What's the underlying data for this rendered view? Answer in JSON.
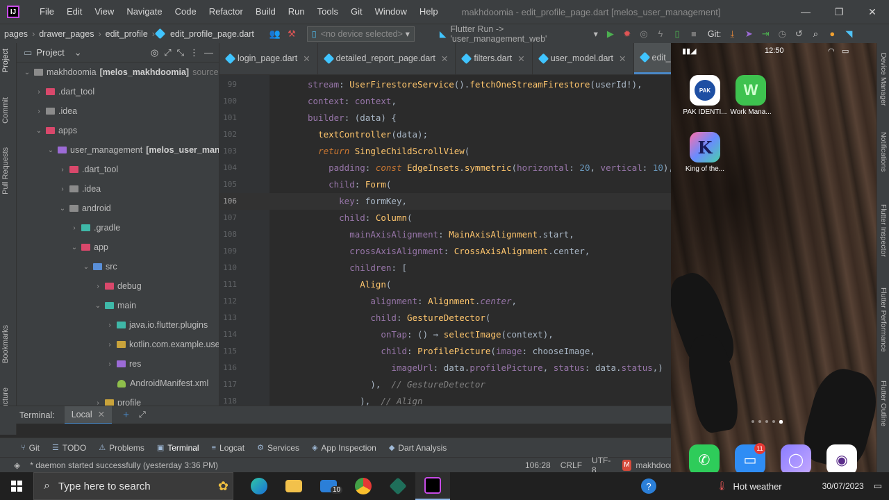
{
  "menubar": {
    "logo": "IJ",
    "items": [
      "File",
      "Edit",
      "View",
      "Navigate",
      "Code",
      "Refactor",
      "Build",
      "Run",
      "Tools",
      "Git",
      "Window",
      "Help"
    ],
    "window_title": "makhdoomia - edit_profile_page.dart [melos_user_management]",
    "controls": [
      "—",
      "❐",
      "✕"
    ]
  },
  "navbar": {
    "breadcrumbs": [
      "pages",
      "drawer_pages",
      "edit_profile",
      "edit_profile_page.dart"
    ],
    "device_select": "<no device selected>",
    "run_config": "Flutter Run -> 'user_management_web'",
    "git_label": "Git:"
  },
  "left_strip": {
    "tabs": [
      "Project",
      "Commit",
      "Pull Requests",
      "Bookmarks",
      "Structure"
    ]
  },
  "project_panel": {
    "title": "Project",
    "tree": [
      {
        "name": "makhdoomia",
        "extra": "[melos_makhdoomia]",
        "dim": "sources r",
        "arrow": "v",
        "icon": "grey",
        "indent": 0
      },
      {
        "name": ".dart_tool",
        "arrow": ">",
        "icon": "red",
        "indent": 1
      },
      {
        "name": ".idea",
        "arrow": ">",
        "icon": "grey",
        "indent": 1
      },
      {
        "name": "apps",
        "arrow": "v",
        "icon": "red",
        "indent": 1
      },
      {
        "name": "user_management",
        "extra": "[melos_user_manager",
        "arrow": "v",
        "icon": "purple",
        "indent": 2
      },
      {
        "name": ".dart_tool",
        "arrow": ">",
        "icon": "red",
        "indent": 3
      },
      {
        "name": ".idea",
        "arrow": ">",
        "icon": "grey",
        "indent": 3
      },
      {
        "name": "android",
        "arrow": "v",
        "icon": "grey",
        "indent": 3
      },
      {
        "name": ".gradle",
        "arrow": ">",
        "icon": "teal",
        "indent": 4
      },
      {
        "name": "app",
        "arrow": "v",
        "icon": "red",
        "indent": 4
      },
      {
        "name": "src",
        "arrow": "v",
        "icon": "blue",
        "indent": 5
      },
      {
        "name": "debug",
        "arrow": ">",
        "icon": "red",
        "indent": 6
      },
      {
        "name": "main",
        "arrow": "v",
        "icon": "teal",
        "indent": 6
      },
      {
        "name": "java.io.flutter.plugins",
        "arrow": ">",
        "icon": "teal",
        "indent": 7
      },
      {
        "name": "kotlin.com.example.user_",
        "arrow": ">",
        "icon": "yellow",
        "indent": 7
      },
      {
        "name": "res",
        "arrow": ">",
        "icon": "purple",
        "indent": 7
      },
      {
        "name": "AndroidManifest.xml",
        "arrow": "",
        "icon": "droid",
        "indent": 7
      },
      {
        "name": "profile",
        "arrow": ">",
        "icon": "yellow",
        "indent": 6
      }
    ]
  },
  "editor_tabs": [
    {
      "label": "login_page.dart",
      "active": false
    },
    {
      "label": "detailed_report_page.dart",
      "active": false
    },
    {
      "label": "filters.dart",
      "active": false
    },
    {
      "label": "user_model.dart",
      "active": false
    },
    {
      "label": "edit_profile_page.dart",
      "active": true
    }
  ],
  "editor": {
    "current_line": 106,
    "lines": [
      {
        "n": "99",
        "html": "<span class='p'>stream</span><span class='t'>: </span><span class='f'>UserFirestoreService</span><span class='t'>().</span><span class='f'>fetchOneStreamFirestore</span><span class='t'>(userId!),</span>"
      },
      {
        "n": "100",
        "html": "<span class='p'>context</span><span class='t'>: </span><span class='p'>context</span><span class='t'>,</span>"
      },
      {
        "n": "101",
        "html": "<span class='p'>builder</span><span class='t'>: (data) {</span>"
      },
      {
        "n": "102",
        "html": "  <span class='f'>textController</span><span class='t'>(data);</span>"
      },
      {
        "n": "103",
        "html": "  <span class='it'>return</span> <span class='f'>SingleChildScrollView</span><span class='t'>(</span>"
      },
      {
        "n": "104",
        "html": "    <span class='p'>padding</span><span class='t'>: </span><span class='it'>const</span> <span class='f'>EdgeInsets</span><span class='t'>.</span><span class='f'>symmetric</span><span class='t'>(</span><span class='p'>horizontal</span><span class='t'>: </span><span class='n'>20</span><span class='t'>, </span><span class='p'>vertical</span><span class='t'>: </span><span class='n'>10</span><span class='t'>),</span>"
      },
      {
        "n": "105",
        "html": "    <span class='p'>child</span><span class='t'>: </span><span class='f'>Form</span><span class='t'>(</span>"
      },
      {
        "n": "106",
        "html": "      <span class='p'>key</span><span class='t'>: formKey,</span>"
      },
      {
        "n": "107",
        "html": "      <span class='p'>child</span><span class='t'>: </span><span class='f'>Column</span><span class='t'>(</span>"
      },
      {
        "n": "108",
        "html": "        <span class='p'>mainAxisAlignment</span><span class='t'>: </span><span class='f'>MainAxisAlignment</span><span class='t'>.start,</span>"
      },
      {
        "n": "109",
        "html": "        <span class='p'>crossAxisAlignment</span><span class='t'>: </span><span class='f'>CrossAxisAlignment</span><span class='t'>.center,</span>"
      },
      {
        "n": "110",
        "html": "        <span class='p'>children</span><span class='t'>: [</span>"
      },
      {
        "n": "111",
        "html": "          <span class='f'>Align</span><span class='t'>(</span>"
      },
      {
        "n": "112",
        "html": "            <span class='p'>alignment</span><span class='t'>: </span><span class='f'>Alignment</span><span class='t'>.</span><span class='p' style='font-style:italic'>center</span><span class='t'>,</span>"
      },
      {
        "n": "113",
        "html": "            <span class='p'>child</span><span class='t'>: </span><span class='f'>GestureDetector</span><span class='t'>(</span>"
      },
      {
        "n": "114",
        "html": "              <span class='p'>onTap</span><span class='t'>: () ⇒ </span><span class='f'>selectImage</span><span class='t'>(context),</span>"
      },
      {
        "n": "115",
        "html": "              <span class='p'>child</span><span class='t'>: </span><span class='f'>ProfilePicture</span><span class='t'>(</span><span class='p'>image</span><span class='t'>: chooseImage,</span>"
      },
      {
        "n": "116",
        "html": "                <span class='p'>imageUrl</span><span class='t'>: data.</span><span class='p'>profilePicture</span><span class='t'>, </span><span class='p'>status</span><span class='t'>: data.</span><span class='p'>status</span><span class='t'>,)</span>"
      },
      {
        "n": "117",
        "html": "            <span class='t'>),  </span><span class='c'>// GestureDetector</span>"
      },
      {
        "n": "118",
        "html": "          <span class='t'>),  </span><span class='c'>// Align</span>"
      }
    ]
  },
  "terminal": {
    "label": "Terminal:",
    "tab": "Local"
  },
  "bottom_tools": [
    {
      "label": "Git",
      "icon": "⑂"
    },
    {
      "label": "TODO",
      "icon": "☰"
    },
    {
      "label": "Problems",
      "icon": "⚠"
    },
    {
      "label": "Terminal",
      "icon": "▣",
      "active": true
    },
    {
      "label": "Logcat",
      "icon": "≡"
    },
    {
      "label": "Services",
      "icon": "⚙"
    },
    {
      "label": "App Inspection",
      "icon": "◈"
    },
    {
      "label": "Dart Analysis",
      "icon": "◆"
    }
  ],
  "statusbar": {
    "message": "* daemon started successfully (yesterday 3:36 PM)",
    "position": "106:28",
    "line_sep": "CRLF",
    "encoding": "UTF-8",
    "project": "makhdoon"
  },
  "emulator": {
    "time": "12:50",
    "apps": [
      {
        "label": "PAK IDENTI...",
        "icon_text": "PAK"
      },
      {
        "label": "Work Mana...",
        "icon_text": "W"
      },
      {
        "label": "King of the...",
        "icon_text": "K"
      }
    ],
    "messages_badge": "11"
  },
  "right_strip": {
    "tabs": [
      "Device Manager",
      "Notifications",
      "Flutter Inspector",
      "Flutter Performance",
      "Flutter Outline"
    ]
  },
  "taskbar": {
    "search_placeholder": "Type here to search",
    "mail_badge": "10",
    "weather": "Hot weather",
    "date": "30/07/2023"
  }
}
